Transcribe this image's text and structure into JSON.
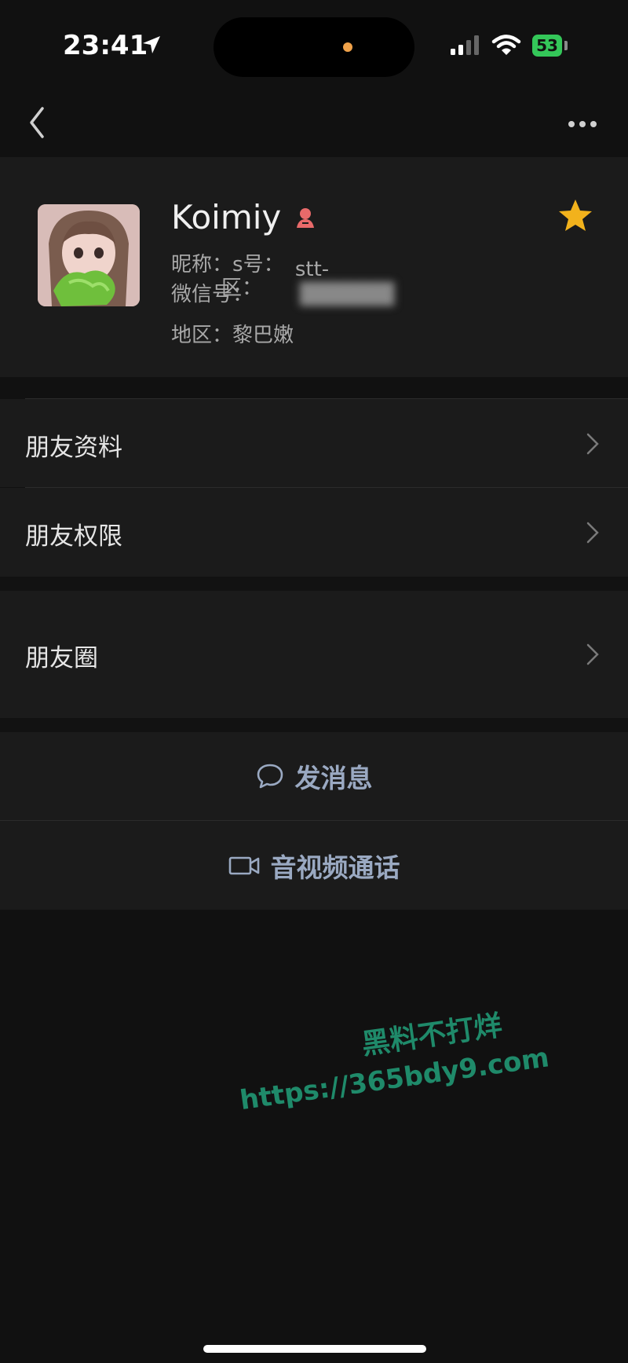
{
  "status_bar": {
    "time": "23:41",
    "battery": "53"
  },
  "profile": {
    "name": "Koimiy",
    "nickname_label": "昵称：",
    "nickname_value": "s",
    "wechat_id_label": "微信号：",
    "wechat_id_value": "stt-",
    "region_label": "地区：",
    "region_value": "黎巴嫩",
    "overlay_text_1": "号：",
    "overlay_text_2": "区："
  },
  "menu": {
    "friend_info": "朋友资料",
    "friend_permissions": "朋友权限",
    "moments": "朋友圈"
  },
  "actions": {
    "send_message": "发消息",
    "video_call": "音视频通话"
  },
  "watermark": {
    "line1": "黑料不打烊",
    "line2": "https://365bdy9.com"
  },
  "colors": {
    "background": "#111111",
    "row_background": "#1b1b1b",
    "action_text": "#9aa9c2",
    "star": "#f2b21c",
    "battery": "#34c759",
    "watermark": "#1f8a6a"
  },
  "icons": [
    "location-arrow-icon",
    "signal-icon",
    "wifi-icon",
    "battery-icon",
    "back-chevron-icon",
    "more-icon",
    "female-icon",
    "star-icon",
    "chevron-right-icon",
    "chat-bubble-icon",
    "video-camera-icon"
  ]
}
